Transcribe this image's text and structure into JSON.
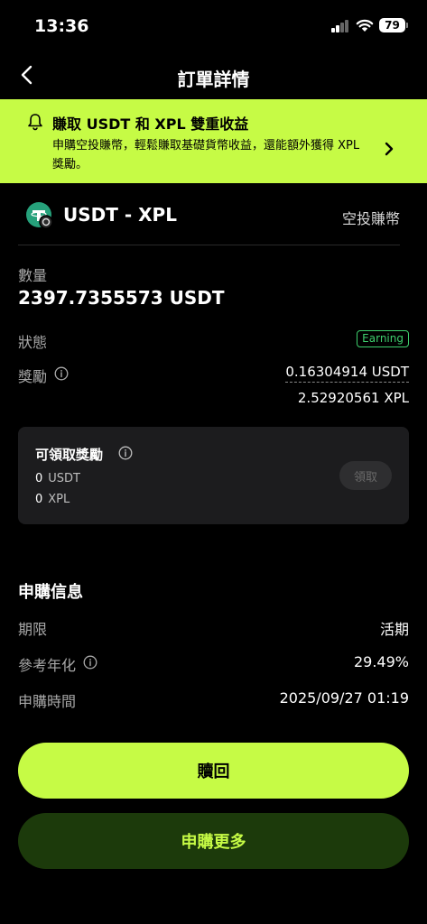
{
  "status_bar": {
    "time": "13:36",
    "battery": "79"
  },
  "nav": {
    "title": "訂單詳情"
  },
  "banner": {
    "title": "賺取 USDT 和 XPL 雙重收益",
    "description": "申購空投賺幣，輕鬆賺取基礎貨幣收益，還能額外獲得 XPL 獎勵。"
  },
  "product": {
    "name": "USDT - XPL",
    "type": "空投賺幣"
  },
  "details": {
    "amount_label": "數量",
    "amount_value": "2397.7355573 USDT",
    "status_label": "狀態",
    "status_value": "Earning",
    "reward_label": "獎勵",
    "reward_usdt": "0.16304914 USDT",
    "reward_xpl": "2.52920561 XPL"
  },
  "claim": {
    "title": "可領取獎勵",
    "usdt_amount": "0",
    "usdt_unit": "USDT",
    "xpl_amount": "0",
    "xpl_unit": "XPL",
    "button_label": "領取"
  },
  "subscription": {
    "title": "申購信息",
    "term_label": "期限",
    "term_value": "活期",
    "apr_label": "參考年化",
    "apr_value": "29.49%",
    "time_label": "申購時間",
    "time_value": "2025/09/27 01:19"
  },
  "actions": {
    "redeem": "贖回",
    "subscribe_more": "申購更多"
  },
  "colors": {
    "accent": "#c6fb45",
    "earning": "#3ecf6d",
    "card": "#1c1c1e"
  }
}
